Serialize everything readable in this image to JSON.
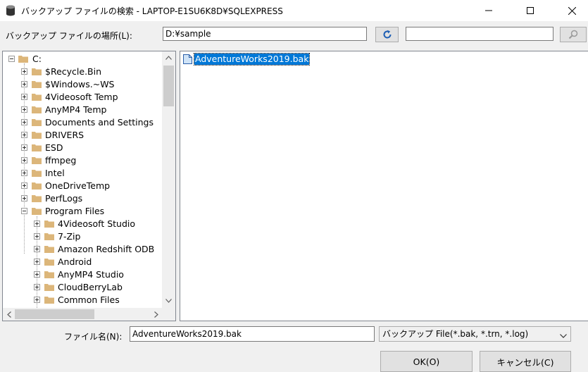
{
  "window": {
    "title": "バックアップ ファイルの検索 - LAPTOP-E1SU6K8D¥SQLEXPRESS",
    "icon": "database-icon",
    "controls": [
      "minimize-icon",
      "maximize-icon",
      "close-icon"
    ]
  },
  "location": {
    "label": "バックアップ ファイルの場所(L):",
    "path": "D:¥sample",
    "refresh_icon": "refresh-icon",
    "search_value": "",
    "search_icon": "search-icon"
  },
  "tree": {
    "root": "C:",
    "items": [
      {
        "label": "$Recycle.Bin"
      },
      {
        "label": "$Windows.~WS"
      },
      {
        "label": "4Videosoft Temp"
      },
      {
        "label": "AnyMP4 Temp"
      },
      {
        "label": "Documents and Settings"
      },
      {
        "label": "DRIVERS"
      },
      {
        "label": "ESD"
      },
      {
        "label": "ffmpeg"
      },
      {
        "label": "Intel"
      },
      {
        "label": "OneDriveTemp"
      },
      {
        "label": "PerfLogs"
      },
      {
        "label": "Program Files"
      },
      {
        "label": "4Videosoft Studio"
      },
      {
        "label": "7-Zip"
      },
      {
        "label": "Amazon Redshift ODB"
      },
      {
        "label": "Android"
      },
      {
        "label": "AnyMP4 Studio"
      },
      {
        "label": "CloudBerryLab"
      },
      {
        "label": "Common Files"
      }
    ]
  },
  "files": [
    {
      "name": "AdventureWorks2019.bak",
      "selected": true
    }
  ],
  "footer": {
    "filename_label": "ファイル名(N):",
    "filename_value": "AdventureWorks2019.bak",
    "filetype_value": "バックアップ File(*.bak, *.trn, *.log)",
    "ok_label": "OK(O)",
    "cancel_label": "キャンセル(C)"
  },
  "colors": {
    "selection": "#0078d7",
    "folder": "#dcb67a",
    "dialog_bg": "#f0f0f0"
  }
}
